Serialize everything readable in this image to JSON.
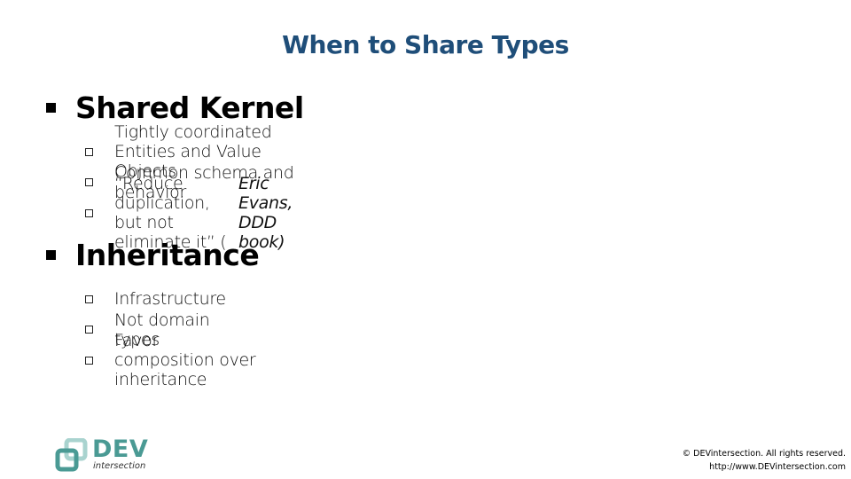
{
  "slide": {
    "title": "When to Share Types",
    "sections": [
      {
        "heading": "Shared Kernel",
        "items": [
          {
            "text": "Tightly coordinated Entities and Value Objects"
          },
          {
            "text": "Common schema and behavior"
          },
          {
            "text": "“Reduce duplication, but not eliminate it” (",
            "citation": "Eric Evans, DDD book)"
          }
        ]
      },
      {
        "heading": "Inheritance",
        "items": [
          {
            "text": "Infrastructure"
          },
          {
            "text": "Not domain types"
          },
          {
            "text": "Favor composition over inheritance"
          }
        ]
      }
    ]
  },
  "logo": {
    "icon": "devintersection-logo-icon",
    "name": "DEV",
    "subtitle": "intersection",
    "color": "#4a9a94"
  },
  "footer": {
    "copyright": "© DEVintersection. All rights reserved.",
    "url": "http://www.DEVintersection.com"
  },
  "colors": {
    "title": "#1f4e79",
    "body_text": "#000000"
  }
}
